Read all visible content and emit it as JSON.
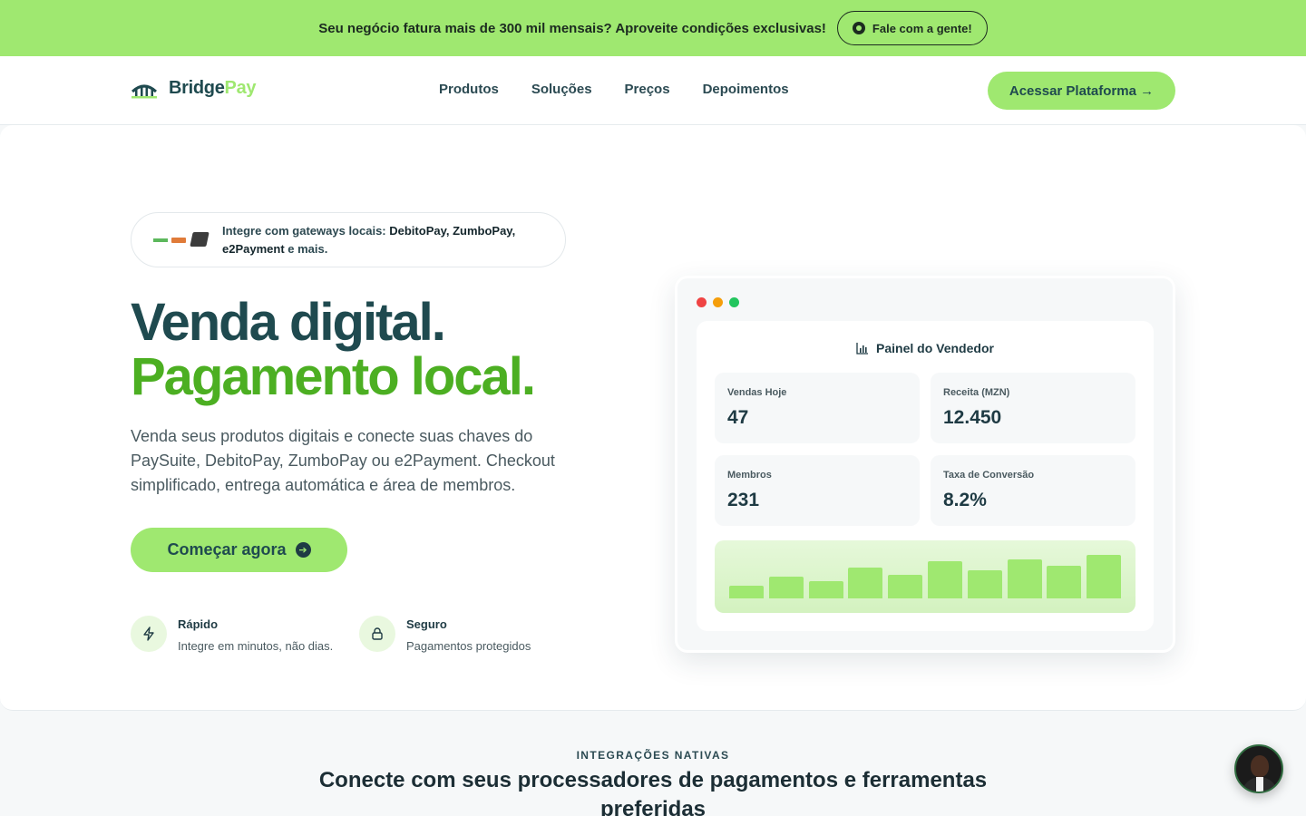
{
  "promo": {
    "text": "Seu negócio fatura mais de 300 mil mensais? Aproveite condições exclusivas!",
    "button": "Fale com a gente!"
  },
  "header": {
    "logo_part1": "Bridge",
    "logo_part2": "Pay",
    "nav": [
      "Produtos",
      "Soluções",
      "Preços",
      "Depoimentos"
    ],
    "cta": "Acessar Plataforma →"
  },
  "hero": {
    "badge": {
      "prefix": "Integre com gateways locais:",
      "gateways": "DebitoPay, ZumboPay, e2Payment",
      "suffix": "e mais."
    },
    "headline_line1": "Venda digital.",
    "headline_line2": "Pagamento local.",
    "subtitle": "Venda seus produtos digitais e conecte suas chaves do PaySuite, DebitoPay, ZumboPay ou e2Payment. Checkout simplificado, entrega automática e área de membros.",
    "cta": "Começar agora",
    "features": [
      {
        "icon": "lightning-icon",
        "title": "Rápido",
        "desc": "Integre em minutos, não dias."
      },
      {
        "icon": "lock-icon",
        "title": "Seguro",
        "desc": "Pagamentos protegidos"
      }
    ]
  },
  "dashboard": {
    "window_dots": [
      "#ef4444",
      "#f59e0b",
      "#22c55e"
    ],
    "title": "Painel do Vendedor",
    "stats": [
      {
        "label": "Vendas Hoje",
        "value": "47"
      },
      {
        "label": "Receita (MZN)",
        "value": "12.450"
      },
      {
        "label": "Membros",
        "value": "231"
      },
      {
        "label": "Taxa de Conversão",
        "value": "8.2%"
      }
    ],
    "bar_levels": [
      0.3,
      0.5,
      0.4,
      0.7,
      0.55,
      0.85,
      0.65,
      0.9,
      0.75,
      1.0
    ]
  },
  "integrations": {
    "eyebrow": "INTEGRAÇÕES NATIVAS",
    "title": "Conecte com seus processadores de pagamentos e ferramentas preferidas"
  },
  "colors": {
    "accent": "#9fe870",
    "brand_dark": "#1f4a4f",
    "headline_green": "#4caf22"
  }
}
